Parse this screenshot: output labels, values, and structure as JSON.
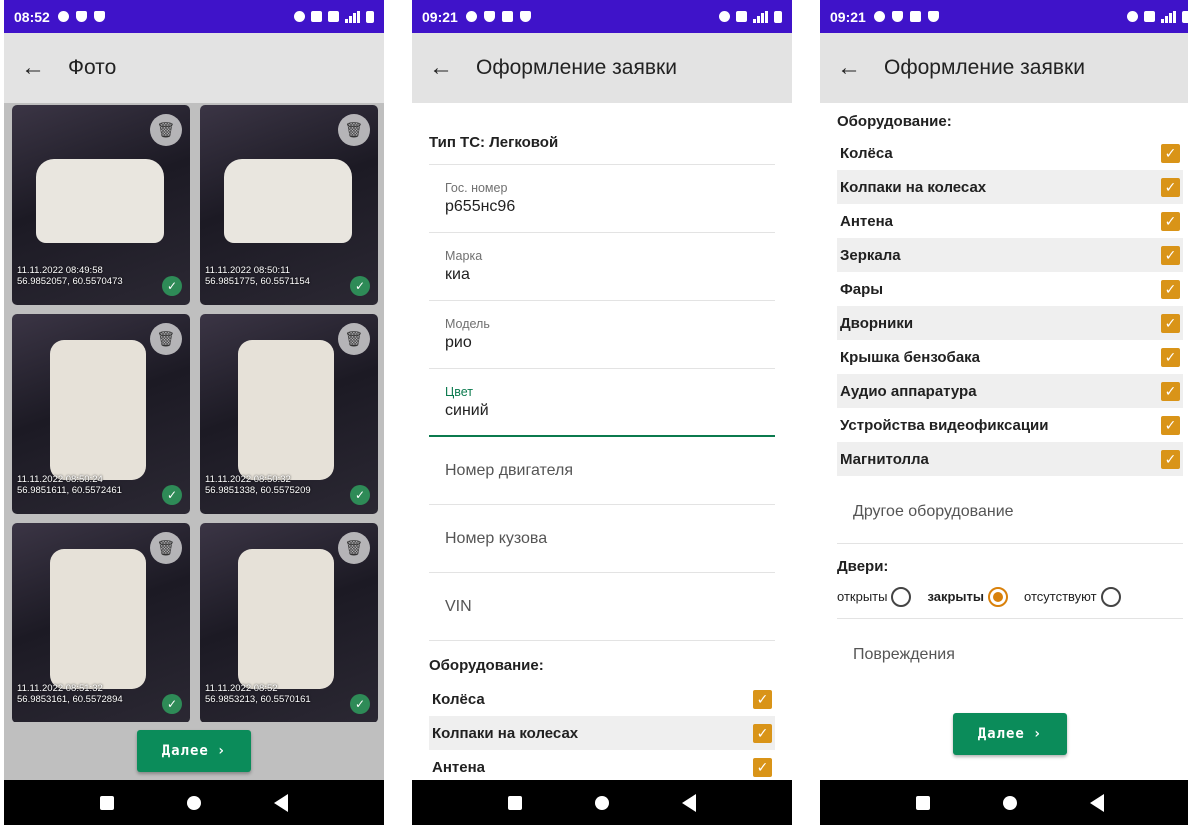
{
  "screen1": {
    "status": {
      "time": "08:52"
    },
    "title": "Фото",
    "photos": [
      {
        "stamp": "11.11.2022 08:49:58",
        "coords": "56.9852057, 60.5570473"
      },
      {
        "stamp": "11.11.2022 08:50:11",
        "coords": "56.9851775, 60.5571154"
      },
      {
        "stamp": "11.11.2022 08:50:24",
        "coords": "56.9851611, 60.5572461"
      },
      {
        "stamp": "11.11.2022 08:50:32",
        "coords": "56.9851338, 60.5575209"
      },
      {
        "stamp": "11.11.2022 08:51:32",
        "coords": "56.9853161, 60.5572894"
      },
      {
        "stamp": "11.11.2022 08:52",
        "coords": "56.9853213, 60.5570161"
      }
    ],
    "next_label": "Далее"
  },
  "screen2": {
    "status": {
      "time": "09:21"
    },
    "title": "Оформление заявки",
    "vehicle_type": "Тип ТС: Легковой",
    "fields": [
      {
        "label": "Гос. номер",
        "value": "р655нс96"
      },
      {
        "label": "Марка",
        "value": "киа"
      },
      {
        "label": "Модель",
        "value": "рио"
      },
      {
        "label": "Цвет",
        "value": "синий"
      }
    ],
    "empty_fields": [
      "Номер двигателя",
      "Номер кузова",
      "VIN"
    ],
    "equipment_title": "Оборудование:",
    "equipment": [
      "Колёса",
      "Колпаки на колесах",
      "Антена"
    ]
  },
  "screen3": {
    "status": {
      "time": "09:21"
    },
    "title": "Оформление заявки",
    "equipment_title": "Оборудование:",
    "equipment": [
      "Колёса",
      "Колпаки на колесах",
      "Антена",
      "Зеркала",
      "Фары",
      "Дворники",
      "Крышка бензобака",
      "Аудио аппаратура",
      "Устройства видеофиксации",
      "Магнитолла"
    ],
    "other_equipment": "Другое оборудование",
    "doors_title": "Двери:",
    "doors": {
      "open": "открыты",
      "closed": "закрыты",
      "absent": "отсутствуют",
      "selected": "закрыты"
    },
    "damage": "Повреждения",
    "next_label": "Далее"
  }
}
